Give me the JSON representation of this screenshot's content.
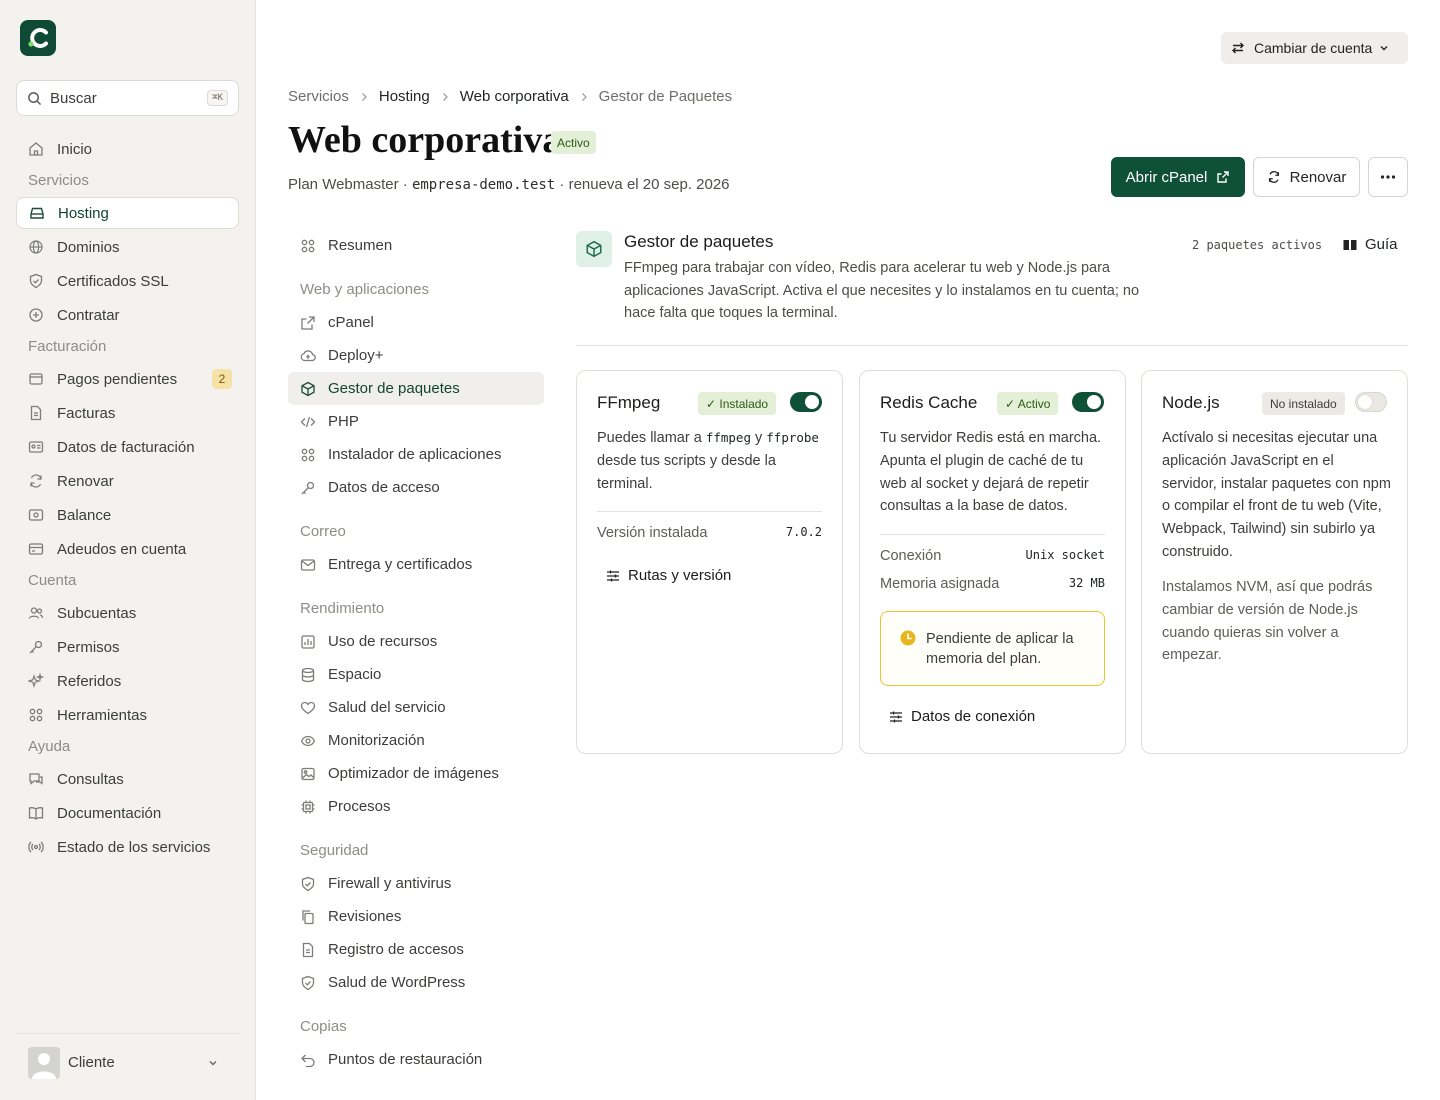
{
  "sidebar": {
    "search": {
      "placeholder": "Buscar",
      "shortcut": "⌘K"
    },
    "items": [
      {
        "label": "Inicio",
        "icon": "home-icon"
      },
      {
        "label": "Hosting",
        "icon": "server-icon",
        "active": true
      },
      {
        "label": "Dominios",
        "icon": "globe-icon"
      },
      {
        "label": "Certificados SSL",
        "icon": "shield-icon"
      },
      {
        "label": "Contratar",
        "icon": "plus-circle-icon"
      },
      {
        "label": "Pagos pendientes",
        "icon": "wallet-icon",
        "badge": "2"
      },
      {
        "label": "Facturas",
        "icon": "file-icon"
      },
      {
        "label": "Datos de facturación",
        "icon": "id-card-icon"
      },
      {
        "label": "Renovar",
        "icon": "refresh-icon"
      },
      {
        "label": "Balance",
        "icon": "banknote-icon"
      },
      {
        "label": "Adeudos en cuenta",
        "icon": "credit-card-icon"
      },
      {
        "label": "Subcuentas",
        "icon": "users-icon"
      },
      {
        "label": "Permisos",
        "icon": "key-icon"
      },
      {
        "label": "Referidos",
        "icon": "sparkles-icon"
      },
      {
        "label": "Herramientas",
        "icon": "grid-icon"
      },
      {
        "label": "Consultas",
        "icon": "chat-icon"
      },
      {
        "label": "Documentación",
        "icon": "book-icon"
      },
      {
        "label": "Estado de los servicios",
        "icon": "radio-icon"
      }
    ],
    "sections": [
      "Servicios",
      "Facturación",
      "Cuenta",
      "Ayuda"
    ],
    "user": {
      "name": "Cliente"
    }
  },
  "topbar": {
    "switch_account": "Cambiar de cuenta"
  },
  "breadcrumb": [
    "Servicios",
    "Hosting",
    "Web corporativa",
    "Gestor de Paquetes"
  ],
  "page": {
    "title": "Web corporativa",
    "status": "Activo",
    "plan_prefix": "Plan Webmaster ·",
    "domain": "empresa-demo.test",
    "renew_text": "· renueva el 20 sep. 2026",
    "open_cpanel": "Abrir cPanel",
    "renew": "Renovar"
  },
  "subnav": {
    "items": [
      {
        "label": "Resumen",
        "icon": "grid-icon"
      },
      {
        "label": "cPanel",
        "icon": "external-link-icon"
      },
      {
        "label": "Deploy+",
        "icon": "cloud-upload-icon"
      },
      {
        "label": "Gestor de paquetes",
        "icon": "package-icon",
        "active": true
      },
      {
        "label": "PHP",
        "icon": "code-icon"
      },
      {
        "label": "Instalador de aplicaciones",
        "icon": "grid-icon"
      },
      {
        "label": "Datos de acceso",
        "icon": "key-icon"
      },
      {
        "label": "Entrega y certificados",
        "icon": "mail-icon"
      },
      {
        "label": "Uso de recursos",
        "icon": "chart-icon"
      },
      {
        "label": "Espacio",
        "icon": "database-icon"
      },
      {
        "label": "Salud del servicio",
        "icon": "heart-icon"
      },
      {
        "label": "Monitorización",
        "icon": "eye-icon"
      },
      {
        "label": "Optimizador de imágenes",
        "icon": "image-icon"
      },
      {
        "label": "Procesos",
        "icon": "cpu-icon"
      },
      {
        "label": "Firewall y antivirus",
        "icon": "shield-icon"
      },
      {
        "label": "Revisiones",
        "icon": "copy-icon"
      },
      {
        "label": "Registro de accesos",
        "icon": "file-icon"
      },
      {
        "label": "Salud de WordPress",
        "icon": "shield-icon"
      },
      {
        "label": "Puntos de restauración",
        "icon": "undo-icon"
      }
    ],
    "sections": [
      "Web y aplicaciones",
      "Correo",
      "Rendimiento",
      "Seguridad",
      "Copias"
    ]
  },
  "packages": {
    "title": "Gestor de paquetes",
    "description": "FFmpeg para trabajar con vídeo, Redis para acelerar tu web y Node.js para aplicaciones JavaScript. Activa el que necesites y lo instalamos en tu cuenta; no hace falta que toques la terminal.",
    "count": "2 paquetes activos",
    "guide": "Guía",
    "cards": [
      {
        "name": "FFmpeg",
        "status": "✓ Instalado",
        "enabled": true,
        "text_pre": "Puedes llamar a ",
        "code1": "ffmpeg",
        "text_mid": " y ",
        "code2": "ffprobe",
        "text_post": " desde tus scripts y desde la terminal.",
        "rows": [
          {
            "k": "Versión instalada",
            "v": "7.0.2"
          }
        ],
        "action": "Rutas y versión"
      },
      {
        "name": "Redis Cache",
        "status": "✓ Activo",
        "enabled": true,
        "text": "Tu servidor Redis está en marcha. Apunta el plugin de caché de tu web al socket y dejará de repetir consultas a la base de datos.",
        "rows": [
          {
            "k": "Conexión",
            "v": "Unix socket"
          },
          {
            "k": "Memoria asignada",
            "v": "32 MB"
          }
        ],
        "notice": "Pendiente de aplicar la memoria del plan.",
        "action": "Datos de conexión"
      },
      {
        "name": "Node.js",
        "status": "No instalado",
        "enabled": false,
        "text": "Actívalo si necesitas ejecutar una aplicación JavaScript en el servidor, instalar paquetes con npm o compilar el front de tu web (Vite, Webpack, Tailwind) sin subirlo ya construido.",
        "text2": "Instalamos NVM, así que podrás cambiar de versión de Node.js cuando quieras sin volver a empezar."
      }
    ]
  },
  "colors": {
    "brand": "#0f5038",
    "accent_soft": "#e3efd6",
    "warning": "#ebc530"
  }
}
